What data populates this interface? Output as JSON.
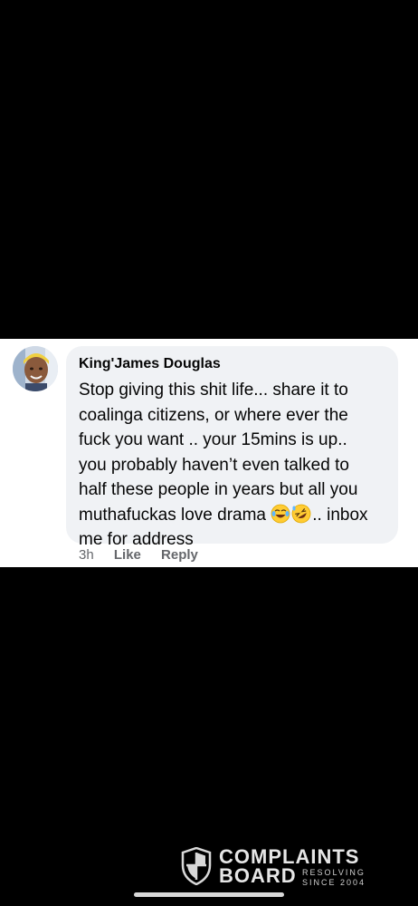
{
  "comment": {
    "author": "King'James Douglas",
    "lines": [
      "Stop giving this shit life... share it to",
      "coalinga citizens, or where ever the",
      "fuck you want .. your 15mins is up..",
      "you probably haven’t even talked to",
      "half these people in years but all you",
      "muthafuckas love drama ",
      ".. inbox",
      "me for address"
    ],
    "emojis": [
      "face-with-tears-of-joy-icon",
      "rolling-on-floor-laughing-icon"
    ]
  },
  "actions": {
    "time": "3h",
    "like_label": "Like",
    "reply_label": "Reply"
  },
  "watermark": {
    "title_line1": "COMPLAINTS",
    "title_line2": "BOARD",
    "tagline_line1": "RESOLVING",
    "tagline_line2": "SINCE 2004"
  },
  "colors": {
    "background": "#000000",
    "panel": "#ffffff",
    "bubble": "#f0f2f5",
    "meta_text": "#65676b"
  }
}
